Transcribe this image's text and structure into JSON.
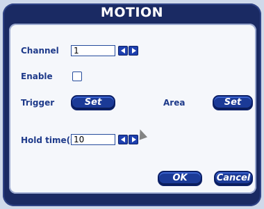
{
  "window": {
    "title": "MOTION"
  },
  "rows": {
    "channel": {
      "label": "Channel",
      "value": "1"
    },
    "enable": {
      "label": "Enable",
      "checked": false
    },
    "trigger": {
      "label": "Trigger",
      "button": "Set"
    },
    "area": {
      "label": "Area",
      "button": "Set"
    },
    "hold_time": {
      "label": "Hold time(s)",
      "value": "10"
    }
  },
  "buttons": {
    "ok": "OK",
    "cancel": "Cancel"
  },
  "icons": {
    "decrement": "arrow-left-icon",
    "increment": "arrow-right-icon",
    "cursor": "mouse-pointer-icon"
  },
  "colors": {
    "frame": "#1a2a63",
    "panel": "#f5f7fb",
    "accent": "#1b3a97",
    "label": "#1e3a8a"
  }
}
